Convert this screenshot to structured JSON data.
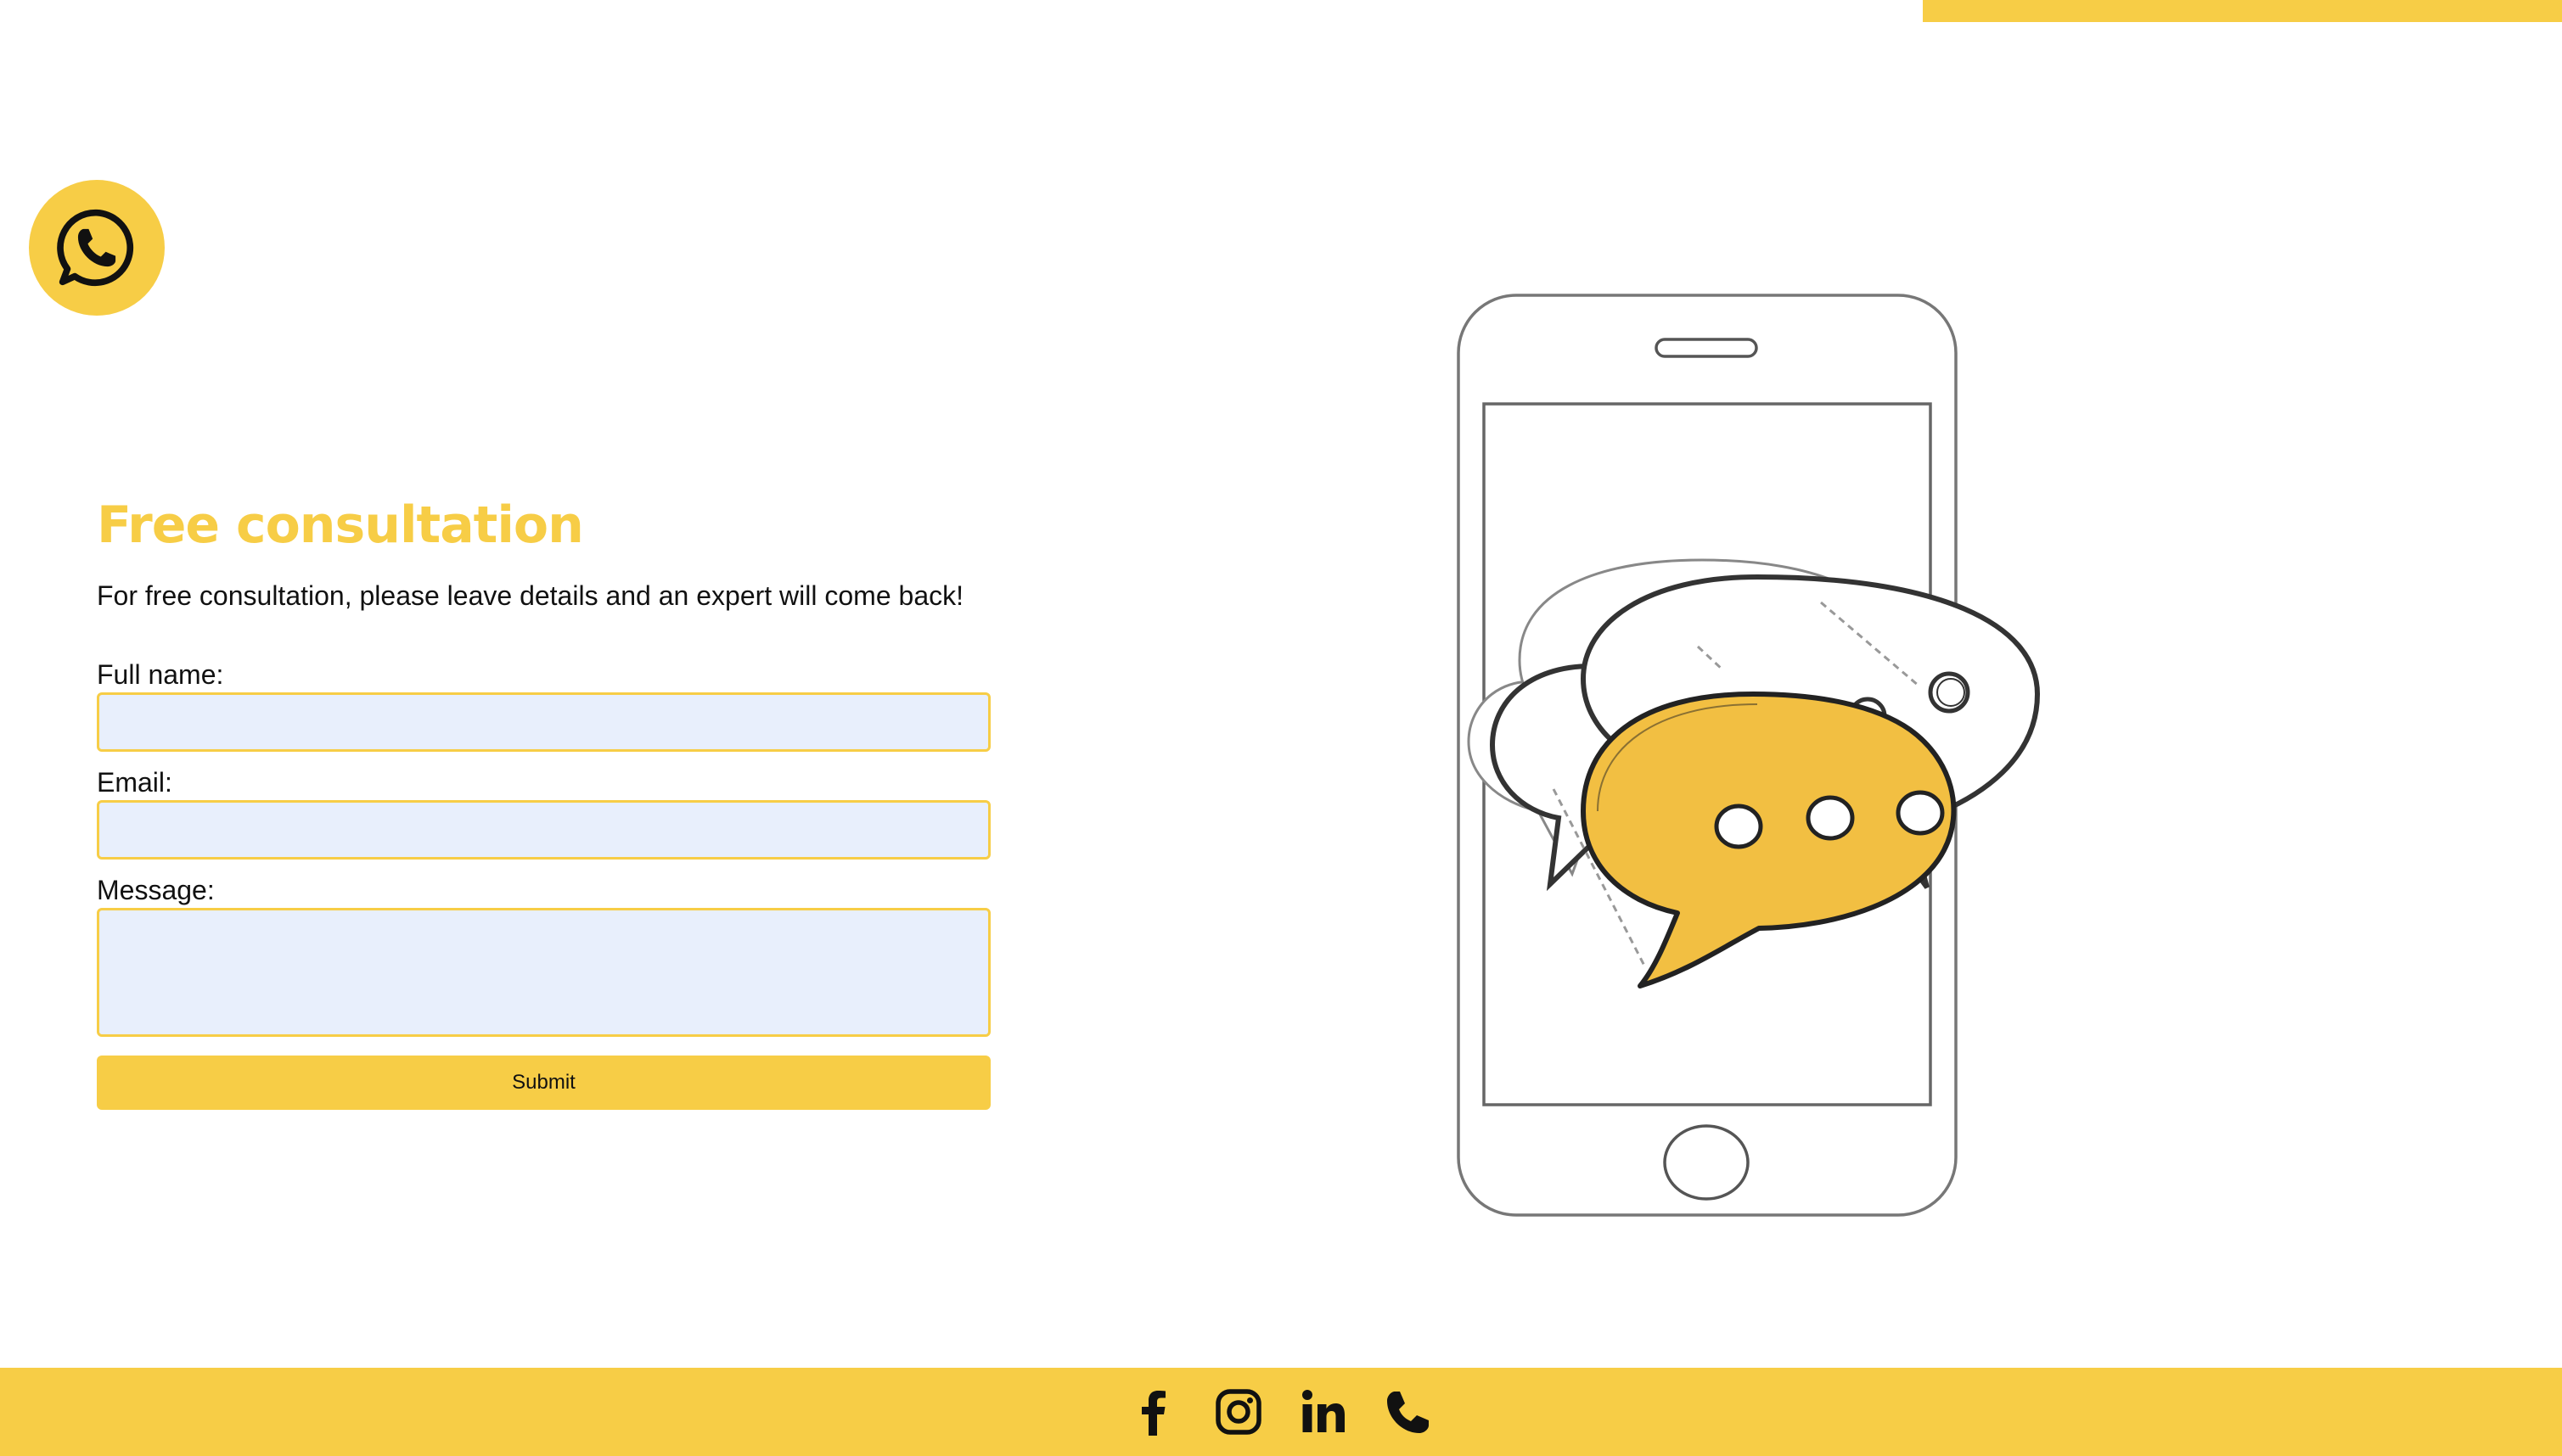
{
  "form": {
    "title": "Free consultation",
    "subtitle": "For free consultation, please leave details and an expert will come back!",
    "fields": [
      {
        "label": "Full name:",
        "value": "",
        "placeholder": ""
      },
      {
        "label": "Email:",
        "value": "",
        "placeholder": ""
      },
      {
        "label": "Message:",
        "value": "",
        "placeholder": ""
      }
    ],
    "submit_label": "Submit"
  },
  "floating": {
    "icon": "whatsapp-icon"
  },
  "illustration": {
    "icon": "phone-chat-bubbles-illustration"
  },
  "footer": {
    "icons": [
      "facebook-icon",
      "instagram-icon",
      "linkedin-icon",
      "phone-icon"
    ]
  },
  "colors": {
    "accent": "#f7cd46",
    "field_bg": "#e8effc",
    "bubble": "#f2bf42"
  }
}
